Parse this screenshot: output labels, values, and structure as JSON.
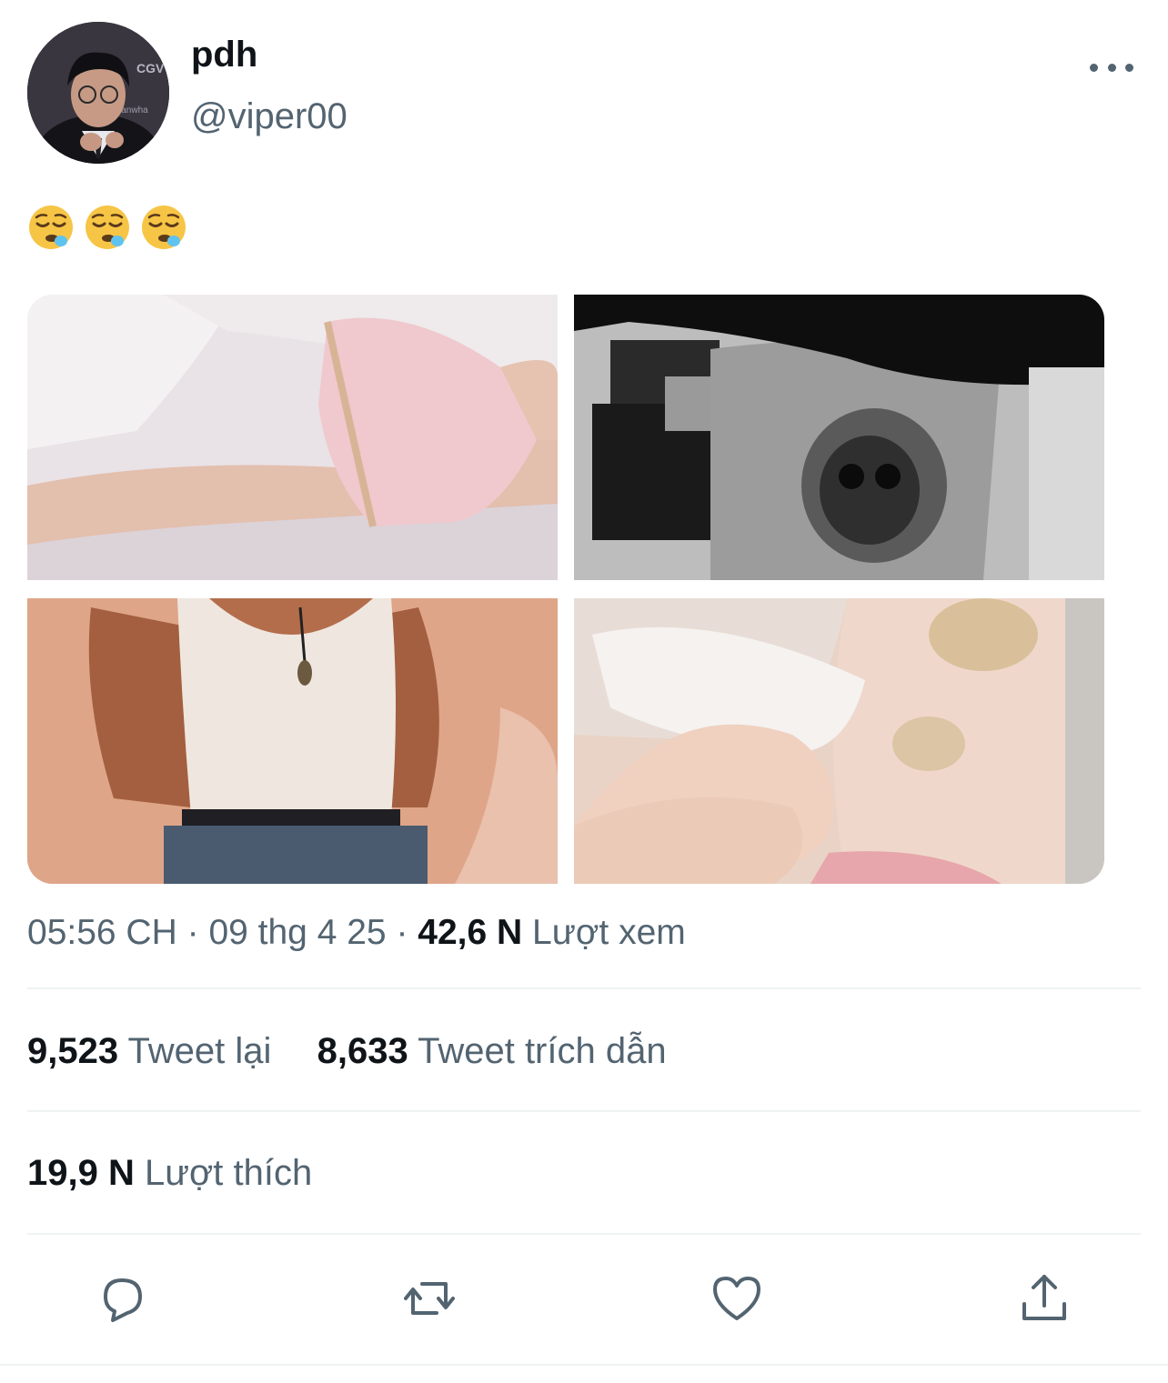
{
  "tweet": {
    "display_name": "pdh",
    "handle": "@viper00",
    "text_emojis": [
      "sleepy-face",
      "sleepy-face",
      "sleepy-face"
    ],
    "media": [
      {
        "name": "photo-1"
      },
      {
        "name": "photo-2"
      },
      {
        "name": "photo-3"
      },
      {
        "name": "photo-4"
      }
    ],
    "time": "05:56 CH",
    "date": "09 thg 4 25",
    "views_count": "42,6 N",
    "views_label": "Lượt xem",
    "retweets_count": "9,523",
    "retweets_label": "Tweet lại",
    "quotes_count": "8,633",
    "quotes_label": "Tweet trích dẫn",
    "likes_count": "19,9 N",
    "likes_label": "Lượt thích"
  },
  "actions": {
    "icons": [
      "reply-icon",
      "retweet-icon",
      "like-icon",
      "share-icon"
    ]
  },
  "colors": {
    "text_primary": "#0f1419",
    "text_secondary": "#536471",
    "divider": "#eff3f4"
  }
}
